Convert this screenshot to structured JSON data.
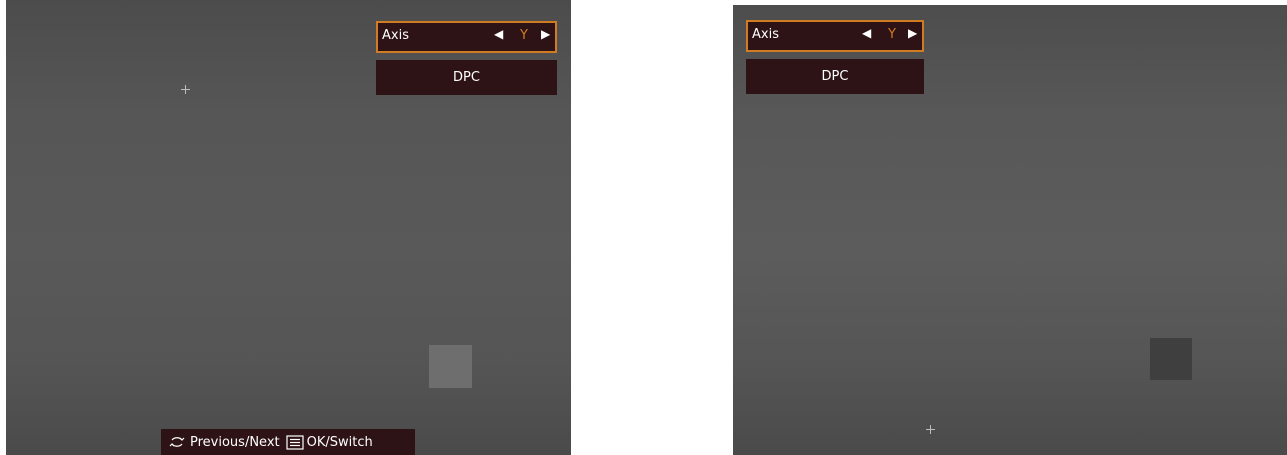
{
  "left_screen": {
    "axis_label": "Axis",
    "axis_value": "Y",
    "dpc_label": "DPC",
    "bottom_bar": {
      "previous_next_label": "Previous/Next",
      "ok_switch_label": "OK/Switch"
    }
  },
  "right_screen": {
    "axis_label": "Axis",
    "axis_value": "Y",
    "dpc_label": "DPC"
  },
  "colors": {
    "accent": "#d07c22",
    "menu_bg": "#2d1316",
    "screen_gray": "#585858"
  }
}
